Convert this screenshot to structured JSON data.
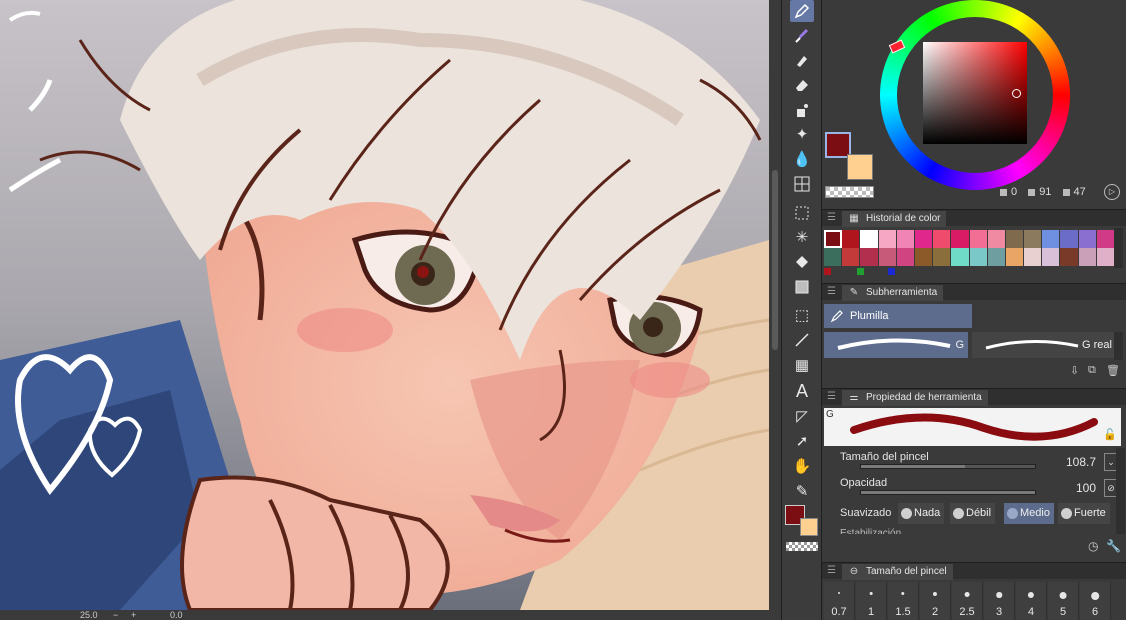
{
  "canvas": {
    "description_label": "drawing canvas"
  },
  "statusbar": {
    "zoom": "25.0",
    "rotation": "0.0"
  },
  "toolbar": {
    "tools": [
      {
        "id": "pen",
        "icon": "pen-icon",
        "active": true
      },
      {
        "id": "brush",
        "icon": "brush-icon",
        "active": false
      },
      {
        "id": "airbrush",
        "icon": "airbrush-icon",
        "active": false
      },
      {
        "id": "eraser",
        "icon": "eraser-icon",
        "active": false
      },
      {
        "id": "decoration",
        "icon": "decoration-icon",
        "active": false
      },
      {
        "id": "sparkle",
        "icon": "sparkle-icon",
        "active": false
      },
      {
        "id": "blend",
        "icon": "blend-icon",
        "active": false
      },
      {
        "id": "mesh",
        "icon": "mesh-icon",
        "active": false
      },
      {
        "id": "select",
        "icon": "selection-icon",
        "active": false
      },
      {
        "id": "auto-select",
        "icon": "auto-select-icon",
        "active": false
      },
      {
        "id": "fill",
        "icon": "fill-icon",
        "active": false
      },
      {
        "id": "gradient",
        "icon": "gradient-icon",
        "active": false
      },
      {
        "id": "object",
        "icon": "object-icon",
        "active": false
      },
      {
        "id": "line",
        "icon": "line-icon",
        "active": false
      },
      {
        "id": "frame",
        "icon": "frame-icon",
        "active": false
      },
      {
        "id": "text",
        "icon": "text-icon",
        "active": false
      },
      {
        "id": "balloon",
        "icon": "balloon-icon",
        "active": false
      },
      {
        "id": "move",
        "icon": "move-icon",
        "active": false
      },
      {
        "id": "hand",
        "icon": "hand-icon",
        "active": false
      },
      {
        "id": "eyedropper",
        "icon": "eyedropper-icon",
        "active": false
      }
    ],
    "text_tool_glyph": "A"
  },
  "colors": {
    "main": "#7a0e12",
    "sub": "#ffd08f",
    "accent": "#6678a6"
  },
  "color_wheel": {
    "h_value": "0",
    "s_value": "91",
    "v_value": "47"
  },
  "color_history": {
    "title": "Historial de color",
    "rows": [
      [
        "#7a0e12",
        "#b0141d",
        "#ffffff",
        "#f6a7c4",
        "#f084b4",
        "#e0288c",
        "#ef4b6c",
        "#d81b64",
        "#f26e94",
        "#f08aa3",
        "#7f6a4e",
        "#8c7a5e",
        "#6f90e0",
        "#6a6cc8",
        "#8a6fd0",
        "#d03a86"
      ],
      [
        "#3c6e5e",
        "#c23a3a",
        "#b2304e",
        "#c75a78",
        "#d04482",
        "#8b5a28",
        "#8a6e3c",
        "#6fdcc8",
        "#7ac8c8",
        "#6e9ea0",
        "#e8a566",
        "#e8d0d0",
        "#d8c0d8",
        "#7a3a2a",
        "#caa0b8",
        "#e0b0c8"
      ]
    ]
  },
  "subtool": {
    "title": "Subherramienta",
    "selected": "Plumilla",
    "brushes": [
      {
        "label": "G",
        "selected": true
      },
      {
        "label": "G real",
        "selected": false
      }
    ]
  },
  "tool_property": {
    "title": "Propiedad de herramienta",
    "preview_tag": "G",
    "brush_size_label": "Tamaño del pincel",
    "brush_size_value": "108.7",
    "brush_size_fraction": 0.6,
    "opacity_label": "Opacidad",
    "opacity_value": "100",
    "opacity_fraction": 1.0,
    "smoothing_label": "Suavizado",
    "smoothing_options": [
      {
        "label": "Nada",
        "selected": false
      },
      {
        "label": "Débil",
        "selected": false
      },
      {
        "label": "Medio",
        "selected": true
      },
      {
        "label": "Fuerte",
        "selected": false
      }
    ],
    "truncated_label": "Estabilización"
  },
  "brush_size_panel": {
    "title": "Tamaño del pincel",
    "sizes": [
      "0.7",
      "1",
      "1.5",
      "2",
      "2.5",
      "3",
      "4",
      "5",
      "6"
    ]
  }
}
